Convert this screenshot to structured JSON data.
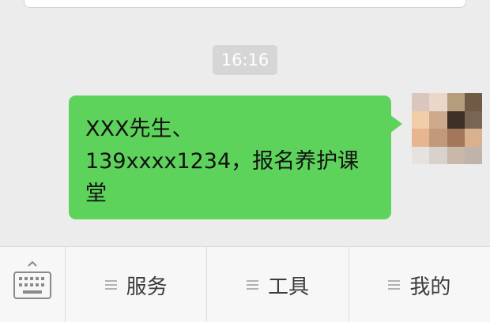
{
  "chat": {
    "timestamp": "16:16",
    "message": "XXX先生、\n139xxxx1234，报名养护课堂"
  },
  "colors": {
    "sent_bubble": "#5ed35c",
    "timestamp_bg": "#d6d6d6",
    "background": "#ececec"
  },
  "icons": {
    "keyboard": "keyboard-icon",
    "menu": "menu-list-icon",
    "avatar": "pixelated-avatar"
  },
  "menu_bar": {
    "items": [
      {
        "label": "服务"
      },
      {
        "label": "工具"
      },
      {
        "label": "我的"
      }
    ]
  }
}
